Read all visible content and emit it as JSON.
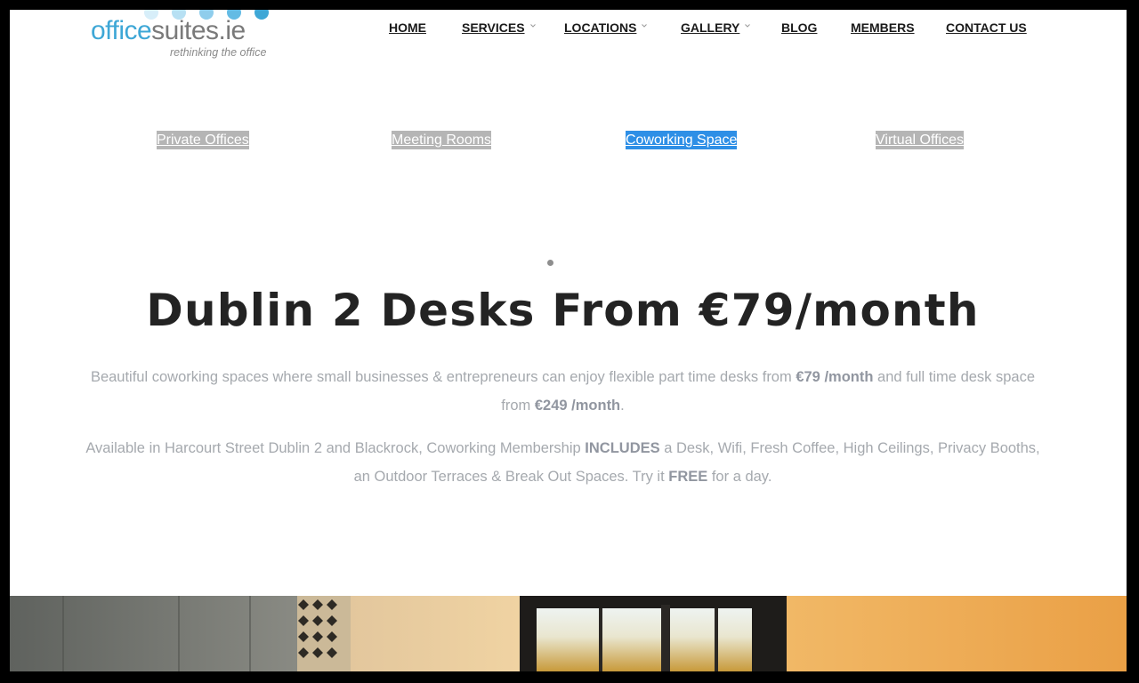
{
  "brand": {
    "name_part1": "office",
    "name_part2": "suites.ie",
    "tagline": "rethinking the office",
    "color_primary": "#3ea7d6",
    "color_secondary": "#7a7a7a"
  },
  "nav": {
    "items": [
      {
        "label": "HOME",
        "has_dropdown": false
      },
      {
        "label": "SERVICES",
        "has_dropdown": true
      },
      {
        "label": "LOCATIONS",
        "has_dropdown": true
      },
      {
        "label": "GALLERY",
        "has_dropdown": true
      },
      {
        "label": "BLOG",
        "has_dropdown": false
      },
      {
        "label": "MEMBERS",
        "has_dropdown": false
      },
      {
        "label": "CONTACT US",
        "has_dropdown": false
      }
    ]
  },
  "service_tabs": {
    "items": [
      {
        "label": "Private Offices",
        "active": false
      },
      {
        "label": "Meeting Rooms",
        "active": false
      },
      {
        "label": "Coworking Space",
        "active": true
      },
      {
        "label": "Virtual Offices",
        "active": false
      }
    ],
    "active_color": "#2e8fe6",
    "inactive_color": "#b5b5b5"
  },
  "hero": {
    "headline": "Dublin 2 Desks From €79/month",
    "para1": {
      "t1": "Beautiful coworking spaces where small businesses & entrepreneurs can enjoy flexible part time desks from ",
      "b1": "€79 /month",
      "t2": " and full time desk space from ",
      "b2": "€249 /month",
      "t3": "."
    },
    "para2": {
      "t1": "Available in Harcourt Street Dublin 2 and Blackrock, Coworking Membership ",
      "b1": "INCLUDES",
      "t2": " a Desk, Wifi, Fresh Coffee, High Ceilings, Privacy Booths, an Outdoor Terraces & Break Out Spaces. Try it ",
      "b2": "FREE",
      "t3": " for a day."
    }
  },
  "icons": {
    "dropdown": "chevron-down-icon",
    "carousel": "carousel-dot-icon"
  }
}
